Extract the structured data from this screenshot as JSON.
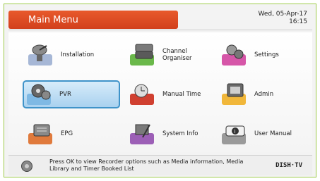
{
  "header": {
    "title": "Main Menu",
    "date": "Wed, 05-Apr-17",
    "time": "16:15"
  },
  "menu": {
    "items": [
      {
        "label": "Installation",
        "icon": "satellite-dish-icon",
        "color": "#a6b7d6"
      },
      {
        "label": "Channel\nOrganiser",
        "icon": "tv-stack-icon",
        "color": "#6ab84a"
      },
      {
        "label": "Settings",
        "icon": "gears-icon",
        "color": "#d656a8"
      },
      {
        "label": "PVR",
        "icon": "film-reel-icon",
        "color": "#7fb9e4"
      },
      {
        "label": "Manual Time",
        "icon": "clock-icon",
        "color": "#d04030"
      },
      {
        "label": "Admin",
        "icon": "admin-screen-icon",
        "color": "#f1b73a"
      },
      {
        "label": "EPG",
        "icon": "guide-book-icon",
        "color": "#e07a3c"
      },
      {
        "label": "System Info",
        "icon": "tools-icon",
        "color": "#9c5fb6"
      },
      {
        "label": "User Manual",
        "icon": "manual-info-icon",
        "color": "#9a9a9a"
      }
    ]
  },
  "footer": {
    "hint": "Press OK to view Recorder options such as Media information, Media Library and Timer Booked List",
    "brand": "DISH·TV"
  }
}
